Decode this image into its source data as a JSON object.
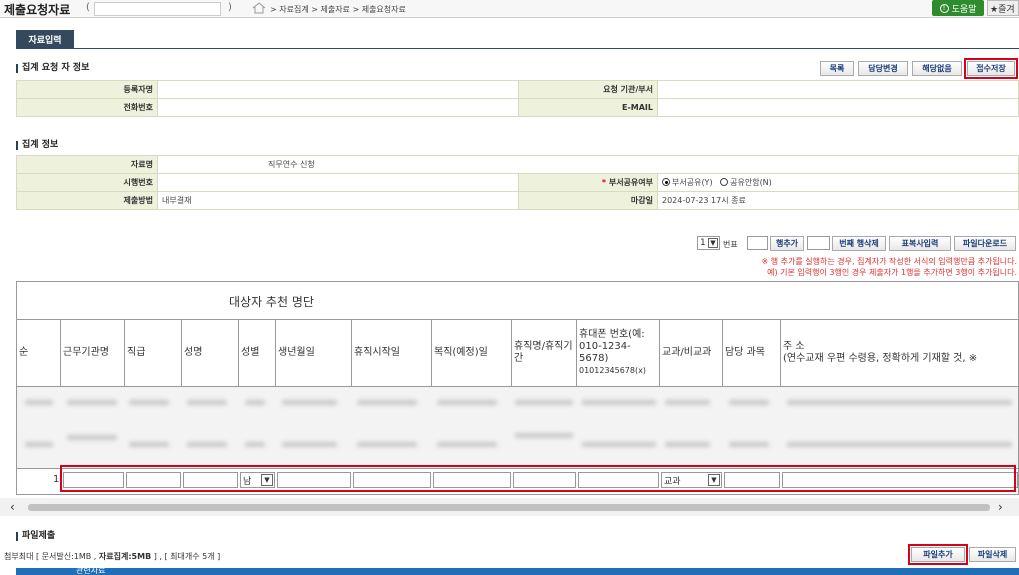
{
  "header": {
    "title": "제출요청자료",
    "paren_open": "(",
    "paren_close": ")",
    "breadcrumb": "> 자료집계 > 제출자료 > 제출요청자료",
    "help_label": "도움말",
    "favorite_label": "★즐겨"
  },
  "tabs": [
    {
      "label": "자료입력"
    }
  ],
  "requester_section": {
    "title": "집계 요청 자 정보",
    "buttons": {
      "list": "목록",
      "change_owner": "담당변경",
      "not_applicable": "해당없음",
      "submit_save": "접수저장"
    },
    "fields": {
      "registrant_label": "등록자명",
      "registrant_value": "",
      "org_label": "요청 기관/부서",
      "org_value": "",
      "phone_label": "전화번호",
      "phone_value": "",
      "email_label": "E-MAIL",
      "email_value": ""
    }
  },
  "collection_section": {
    "title": "집계 정보",
    "fields": {
      "name_label": "자료명",
      "name_value": "직무연수 신청",
      "enforce_no_label": "시행번호",
      "enforce_no_value": "",
      "share_label": "부서공유여부",
      "share_required": "*",
      "share_options": [
        "부서공유(Y)",
        "공유안함(N)"
      ],
      "share_selected": "부서공유(Y)",
      "method_label": "제출방법",
      "method_value": "내부결재",
      "deadline_label": "마감일",
      "deadline_value": "2024-07-23 17시 종료"
    }
  },
  "grid_controls": {
    "row_select": "1",
    "row_no_label": "번표",
    "add_row": "행추가",
    "delete_row": "번째 행삭제",
    "copy_paste": "표복사입력",
    "download": "파일다운로드",
    "notice1": "※ 행 추가를 실행하는 경우, 집계자가 작성한 서식의 입력행만큼 추가됩니다.",
    "notice2": "예) 기본 입력행이 3행인 경우 제출자가 1행을 추가하면 3행이 추가됩니다."
  },
  "grid": {
    "title": "대상자 추천 명단",
    "columns": [
      "순",
      "근무기관명",
      "직급",
      "성명",
      "성별",
      "생년월일",
      "휴직시작일",
      "복직(예정)일",
      "휴직명/휴직기간",
      "휴대폰 번호(예: 010-1234-5678)",
      "01012345678(x)",
      "교과/비교과",
      "담당 과목",
      "주 소",
      "(연수교재 우편 수령용, 정확하게 기재할 것, ※"
    ],
    "input_row": {
      "index": "1",
      "gender": "남",
      "subject_type": "교과"
    }
  },
  "file_section": {
    "title": "파일제출",
    "limits": "첨부최대 [ 문서발신:1MB , ",
    "limits_bold": "자료집계:5MB",
    "limits_tail": " ] , [ 최대개수 5개 ]",
    "add_file": "파일추가",
    "delete_file": "파일삭제",
    "related": "관련자료"
  }
}
